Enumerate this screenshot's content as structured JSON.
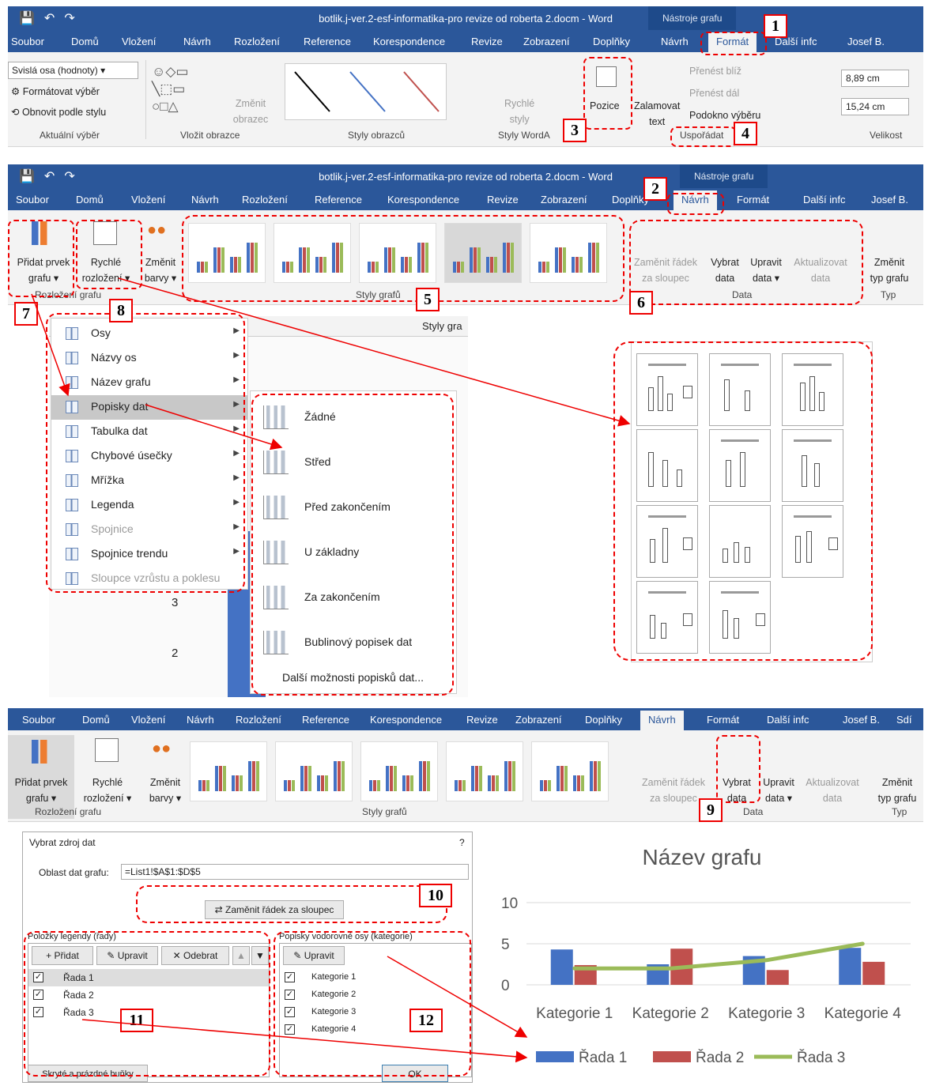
{
  "p1": {
    "title": "botlik.j-ver.2-esf-informatika-pro revize od roberta 2.docm - Word",
    "tools": "Nástroje grafu",
    "tabs": [
      "Soubor",
      "Domů",
      "Vložení",
      "Návrh",
      "Rozložení",
      "Reference",
      "Korespondence",
      "Revize",
      "Zobrazení",
      "Doplňky",
      "Návrh",
      "Formát",
      "Další infc",
      "Josef B."
    ],
    "selected_tab": "Formát",
    "dropdown": "Svislá osa (hodnoty)",
    "format_sel": "Formátovat výběr",
    "reset": "Obnovit podle stylu",
    "g_current": "Aktuální výběr",
    "change": "Změnit",
    "shape": "obrazec",
    "g_insert": "Vložit obrazce",
    "g_styles": "Styly obrazců",
    "quick": "Rychlé",
    "styles": "styly",
    "g_wordart": "Styly WordA",
    "position": "Pozice",
    "wrap": "Zalamovat",
    "text": "text",
    "forward": "Přenést blíž",
    "backward": "Přenést dál",
    "pane": "Podokno výběru",
    "g_arrange": "Uspořádat",
    "height": "8,89 cm",
    "width": "15,24 cm",
    "g_size": "Velikost"
  },
  "p2": {
    "title": "botlik.j-ver.2-esf-informatika-pro revize od roberta 2.docm - Word",
    "tools": "Nástroje grafu",
    "tabs": [
      "Soubor",
      "Domů",
      "Vložení",
      "Návrh",
      "Rozložení",
      "Reference",
      "Korespondence",
      "Revize",
      "Zobrazení",
      "Doplňky",
      "Návrh",
      "Formát",
      "Další infc",
      "Josef B."
    ],
    "add1": "Přidat prvek",
    "add2": "grafu",
    "quick1": "Rychlé",
    "quick2": "rozložení",
    "colors1": "Změnit",
    "colors2": "barvy",
    "g_layout": "Rozložení grafu",
    "g_styles": "Styly grafů",
    "swap1": "Zaměnit řádek",
    "swap2": "za sloupec",
    "select1": "Vybrat",
    "select2": "data",
    "edit1": "Upravit",
    "edit2": "data",
    "refresh1": "Aktualizovat",
    "refresh2": "data",
    "g_data": "Data",
    "type1": "Změnit",
    "type2": "typ grafu",
    "g_type": "Typ"
  },
  "menu": {
    "header": "Styly gra",
    "items": [
      "Osy",
      "Názvy os",
      "Název grafu",
      "Popisky dat",
      "Tabulka dat",
      "Chybové úsečky",
      "Mřížka",
      "Legenda",
      "Spojnice",
      "Spojnice trendu",
      "Sloupce vzrůstu a poklesu"
    ]
  },
  "submenu": {
    "items": [
      "Žádné",
      "Střed",
      "Před zakončením",
      "U základny",
      "Za zakončením",
      "Bublinový popisek dat"
    ],
    "more": "Další možnosti popisků dat..."
  },
  "bg_nums": [
    "3",
    "2"
  ],
  "p3": {
    "tabs": [
      "Soubor",
      "Domů",
      "Vložení",
      "Návrh",
      "Rozložení",
      "Reference",
      "Korespondence",
      "Revize",
      "Zobrazení",
      "Doplňky",
      "Návrh",
      "Formát",
      "Další infc",
      "Josef B.",
      "Sdí"
    ],
    "add1": "Přidat prvek",
    "add2": "grafu",
    "quick1": "Rychlé",
    "quick2": "rozložení",
    "colors1": "Změnit",
    "colors2": "barvy",
    "g_layout": "Rozložení grafu",
    "g_styles": "Styly grafů",
    "swap1": "Zaměnit řádek",
    "swap2": "za sloupec",
    "select1": "Vybrat",
    "select2": "data",
    "edit1": "Upravit",
    "edit2": "data",
    "refresh1": "Aktualizovat",
    "refresh2": "data",
    "g_data": "Data",
    "type1": "Změnit",
    "type2": "typ grafu",
    "g_type": "Typ"
  },
  "dialog": {
    "title": "Vybrat zdroj dat",
    "help": "?",
    "range_label": "Oblast dat grafu:",
    "range": "=List1!$A$1:$D$5",
    "swap": "Zaměnit řádek za sloupec",
    "legend_title": "Položky legendy (řady)",
    "add": "Přidat",
    "edit": "Upravit",
    "remove": "Odebrat",
    "series": [
      "Řada 1",
      "Řada 2",
      "Řada 3"
    ],
    "axis_title": "Popisky vodorovné osy (kategorie)",
    "axis_edit": "Upravit",
    "categories": [
      "Kategorie 1",
      "Kategorie 2",
      "Kategorie 3",
      "Kategorie 4"
    ],
    "hidden": "Skryté a prázdné buňky",
    "ok": "OK"
  },
  "callouts": [
    "1",
    "2",
    "3",
    "4",
    "5",
    "6",
    "7",
    "8",
    "9",
    "10",
    "11",
    "12"
  ],
  "chart_data": {
    "type": "bar",
    "title": "Název grafu",
    "categories": [
      "Kategorie 1",
      "Kategorie 2",
      "Kategorie 3",
      "Kategorie 4"
    ],
    "ylim": [
      0,
      10
    ],
    "yticks": [
      "10",
      "5",
      "0"
    ],
    "series": [
      {
        "name": "Řada 1",
        "type": "bar",
        "color": "#4472c4",
        "values": [
          4.3,
          2.5,
          3.5,
          4.5
        ]
      },
      {
        "name": "Řada 2",
        "type": "bar",
        "color": "#c0504d",
        "values": [
          2.4,
          4.4,
          1.8,
          2.8
        ]
      },
      {
        "name": "Řada 3",
        "type": "line",
        "color": "#9bbb59",
        "values": [
          2,
          2,
          3,
          5
        ]
      }
    ],
    "legend": "bottom",
    "grid": true
  }
}
